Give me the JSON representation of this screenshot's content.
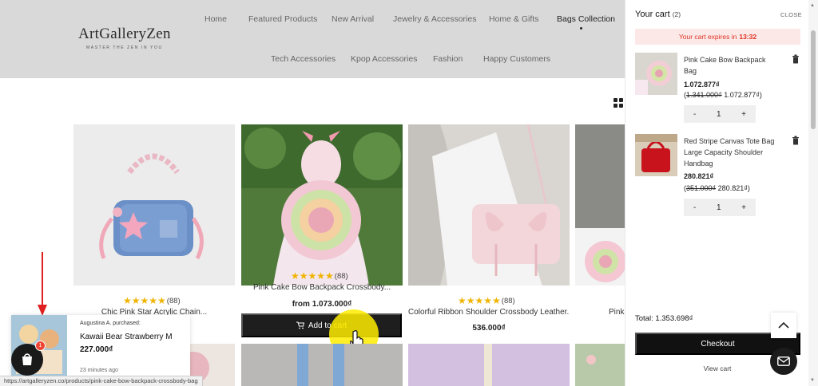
{
  "header": {
    "logo_text": "ArtGalleryZen",
    "logo_tagline": "MASTER THE ZEN IN YOU",
    "nav_row1": [
      "Home",
      "Featured Products",
      "New Arrival",
      "Jewelry & Accessories",
      "Home & Gifts",
      "Bags Collection"
    ],
    "nav_row2": [
      "Tech Accessories",
      "Kpop Accessories",
      "Fashion",
      "Happy Customers"
    ],
    "active_nav": "Bags Collection"
  },
  "products": [
    {
      "title": "Chic Pink Star Acrylic Chain...",
      "rating_count": "(88)",
      "price": ""
    },
    {
      "title": "Pink Cake Bow Backpack Crossbody...",
      "rating_count": "(88)",
      "price": "from 1.073.000₫"
    },
    {
      "title": "Colorful Ribbon Shoulder Crossbody Leather...",
      "rating_count": "(88)",
      "price": "536.000₫"
    },
    {
      "title": "Pink",
      "rating_count": "",
      "price": ""
    }
  ],
  "add_to_cart": {
    "label_a": "Add to ",
    "label_b": "cart"
  },
  "popup": {
    "who": "Augustina A. purchased:",
    "item": "Kawaii Bear Strawberry M",
    "price": "227.000₫",
    "time": "23 minutes ago"
  },
  "shop_badge": "1",
  "status_url": "https://artgalleryzen.co/products/pink-cake-bow-backpack-crossbody-bag",
  "cart": {
    "title": "Your cart",
    "count": "(2)",
    "close": "CLOSE",
    "expiry_text": "Your cart expires in",
    "expiry_time": "13:32",
    "items": [
      {
        "name": "Pink Cake Bow Backpack Bag",
        "price": "1.072.877₫",
        "was": "1.341.000₫",
        "now": "1.072.877₫",
        "qty": "1"
      },
      {
        "name": "Red Stripe Canvas Tote Bag Large Capacity Shoulder Handbag",
        "price": "280.821₫",
        "was": "351.000₫",
        "now": "280.821₫",
        "qty": "1"
      }
    ],
    "stepper_minus": "-",
    "stepper_plus": "+",
    "total": "Total: 1.353.698₫",
    "checkout": "Checkout",
    "view_cart": "View cart"
  },
  "icons": {
    "grid": "grid-view-icon",
    "trash": "trash-icon",
    "cart": "cart-icon",
    "shop": "shopify-bag-icon",
    "back_to_top": "chevron-up-icon",
    "mail": "mail-icon"
  },
  "colors": {
    "header_bg": "#d9d9d9",
    "expiry_red": "#dd3322",
    "star": "#f0b400",
    "button_dark": "#1e1e1e"
  }
}
